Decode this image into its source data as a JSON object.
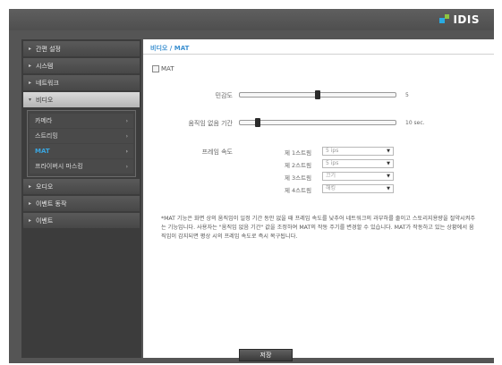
{
  "brand": {
    "logo_text": "IDIS"
  },
  "sidebar": {
    "items": [
      {
        "label": "간편 설정",
        "caret": "▸"
      },
      {
        "label": "시스템",
        "caret": "▸"
      },
      {
        "label": "네트워크",
        "caret": "▸"
      },
      {
        "label": "비디오",
        "caret": "▾"
      },
      {
        "label": "오디오",
        "caret": "▸"
      },
      {
        "label": "이벤트 동작",
        "caret": "▸"
      },
      {
        "label": "이벤트",
        "caret": "▸"
      }
    ],
    "video_submenu": [
      {
        "label": "카메라",
        "chev": "›"
      },
      {
        "label": "스트리밍",
        "chev": "›"
      },
      {
        "label": "MAT",
        "chev": "›"
      },
      {
        "label": "프라이버시 마스킹",
        "chev": "›"
      }
    ]
  },
  "content": {
    "breadcrumb": "비디오 / MAT",
    "mat_checkbox_label": "MAT",
    "sensitivity": {
      "label": "민감도",
      "value": "5",
      "level_fraction": 0.5
    },
    "inactivity": {
      "label": "움직임 없음 기간",
      "value": "10 sec.",
      "level_fraction": 0.1
    },
    "frame_rate": {
      "label": "프레임 속도",
      "streams": [
        {
          "label": "제 1스트림",
          "value": "5 ips"
        },
        {
          "label": "제 2스트림",
          "value": "5 ips"
        },
        {
          "label": "제 3스트림",
          "value": "끄기"
        },
        {
          "label": "제 4스트림",
          "value": "해킹"
        }
      ]
    },
    "note": "*MAT 기능은 화면 상의 움직임이 일정 기간 동안 없을 때 프레임 속도를 낮추어 네트워크의 과부하를 줄이고 스토리지용량을 절약시켜주는 기능입니다. 사용자는 \"움직임 없음 기간\" 값을 조정하여 MAT의 작동 주기를 변경할 수 있습니다. MAT가 작동하고 있는 상황에서 움직임이 감지되면 평상 시의 프레임 속도로 즉시 복구됩니다."
  },
  "footer": {
    "save_label": "저장"
  },
  "colors": {
    "accent": "#3a8fd0",
    "chrome": "#555555",
    "sidebar_bg": "#3c3c3c"
  },
  "icons": {
    "select_arrow": "▼"
  }
}
